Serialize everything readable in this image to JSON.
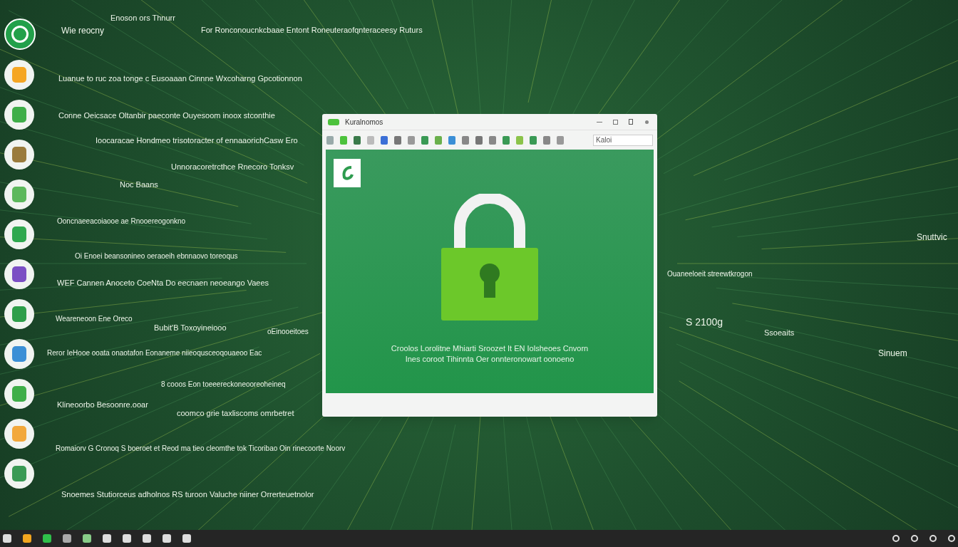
{
  "desktop_texts": [
    {
      "text": "Enoson ors Thnurr"
    },
    {
      "text": "Wie reocny"
    },
    {
      "text": "For Ronconoucnkcbaae Entont Roneuteraofqnteraceesy Ruturs"
    },
    {
      "text": "Luanue to ruc zoa tonge c Eusoaaan Cinnne Wxcoharng Gpcotionnon"
    },
    {
      "text": "Conne Oeicsace Oltanbir paeconte Ouyesoom inoox stconthie"
    },
    {
      "text": "Ioocaracae Hondmeo trisotoracter of ennaaorichCasw Ero"
    },
    {
      "text": "Unnoracoretrcthce Rnecoro Tonksv"
    },
    {
      "text": "Noc Baans"
    },
    {
      "text": "Ooncnaeeacoiaooe ae Rnooereogonkno"
    },
    {
      "text": "Oi Enoei beansonineo oeraoeih ebnnaovo toreoqus"
    },
    {
      "text": "WEF Cannen Anoceto CoeNta Do eecnaen neoeango Vaees"
    },
    {
      "text": "Weareneoon Ene Oreco"
    },
    {
      "text": "Bubit'B Toxoyineiooo"
    },
    {
      "text": "oEinooeitoes"
    },
    {
      "text": "Reror IeHooe ooata onaotafon Eonaneme niieoqusceoqouaeoo Eac"
    },
    {
      "text": "8 cooos Eon toeeereckoneooreoheineq"
    },
    {
      "text": "Klineoorbo Besoonre.ooar"
    },
    {
      "text": "coomco grie taxliscoms omrbetret"
    },
    {
      "text": "Romaiorv G Cronoq S boeroet et Reod ma tieo cleomthe tok Ticoribao Oin rinecoorte Noorv"
    },
    {
      "text": "Snoemes Stutiorceus adholnos RS turoon Valuche niiner Orrerteuetnolor"
    },
    {
      "text": "Ouaneeloeit streewtkrogon"
    },
    {
      "text": "S 2100g"
    },
    {
      "text": "Ssoeaits"
    },
    {
      "text": "Sinuem"
    },
    {
      "text": "Snuttvic"
    }
  ],
  "window": {
    "title": "Kuralnomos",
    "search": {
      "value": "Kaloi"
    },
    "message": [
      "Croolos Lorolitne Mhiarti Sroozet It EN Iolsheoes Cnvorn",
      "Ines coroot Tihinnta Oer onnteronowart oonoeno"
    ]
  }
}
